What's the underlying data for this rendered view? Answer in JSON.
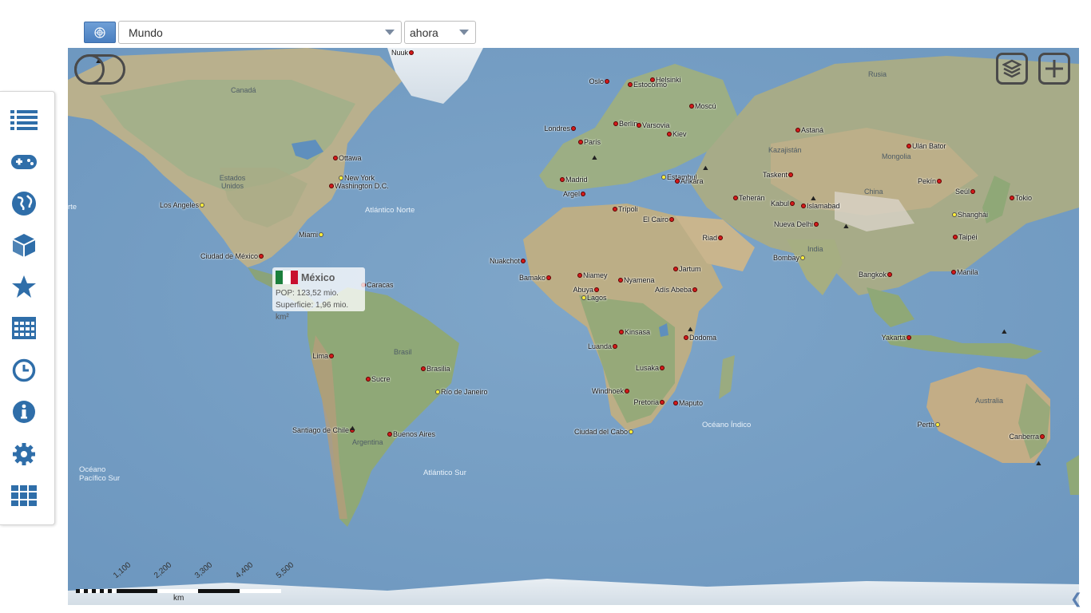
{
  "header": {
    "region_select": {
      "value": "Mundo"
    },
    "time_select": {
      "value": "ahora"
    },
    "flag_icon": "un-flag-icon"
  },
  "sidebar": {
    "items": [
      {
        "icon": "list-icon"
      },
      {
        "icon": "gamepad-icon"
      },
      {
        "icon": "globe-icon"
      },
      {
        "icon": "cube-icon"
      },
      {
        "icon": "star-icon"
      },
      {
        "icon": "calendar-grid-icon"
      },
      {
        "icon": "clock-icon"
      },
      {
        "icon": "info-icon"
      },
      {
        "icon": "gear-icon"
      },
      {
        "icon": "apps-grid-icon"
      }
    ],
    "accent_color": "#2f6ea9"
  },
  "map": {
    "controls": {
      "layers_icon": "layers-icon",
      "add_icon": "plus-icon",
      "toggle_icon": "toggle-icon"
    },
    "regions": [
      "Canadá",
      "Rusia",
      "Estados Unidos",
      "Kazajistán",
      "Mongolia",
      "China",
      "India",
      "Brasil",
      "Argentina",
      "Australia"
    ],
    "oceans": [
      "Atlántico Norte",
      "Atlántico Sur",
      "Océano Índico",
      "Océano Pacífico Sur",
      "rte"
    ],
    "cities": [
      {
        "name": "Nuuk",
        "color": "red"
      },
      {
        "name": "Oslo",
        "color": "red"
      },
      {
        "name": "Helsinki",
        "color": "red"
      },
      {
        "name": "Estocolmo",
        "color": "red"
      },
      {
        "name": "Moscú",
        "color": "red"
      },
      {
        "name": "Londres",
        "color": "red"
      },
      {
        "name": "Berlín",
        "color": "red"
      },
      {
        "name": "Varsovia",
        "color": "red"
      },
      {
        "name": "París",
        "color": "red"
      },
      {
        "name": "Kiev",
        "color": "red"
      },
      {
        "name": "Astaná",
        "color": "red"
      },
      {
        "name": "Ulán Bator",
        "color": "red"
      },
      {
        "name": "Ottawa",
        "color": "red"
      },
      {
        "name": "New York",
        "color": "yellow"
      },
      {
        "name": "Washington D.C.",
        "color": "red"
      },
      {
        "name": "Madrid",
        "color": "red"
      },
      {
        "name": "Estambul",
        "color": "yellow"
      },
      {
        "name": "Ankara",
        "color": "red"
      },
      {
        "name": "Taskent",
        "color": "red"
      },
      {
        "name": "Pekín",
        "color": "red"
      },
      {
        "name": "Seúl",
        "color": "red"
      },
      {
        "name": "Tokio",
        "color": "red"
      },
      {
        "name": "Los Angeles",
        "color": "yellow"
      },
      {
        "name": "Argel",
        "color": "red"
      },
      {
        "name": "Teherán",
        "color": "red"
      },
      {
        "name": "Kabul",
        "color": "red"
      },
      {
        "name": "Islamabad",
        "color": "red"
      },
      {
        "name": "Shanghái",
        "color": "yellow"
      },
      {
        "name": "Trípoli",
        "color": "red"
      },
      {
        "name": "El Cairo",
        "color": "red"
      },
      {
        "name": "Nueva Delhi",
        "color": "red"
      },
      {
        "name": "Miami",
        "color": "yellow"
      },
      {
        "name": "Riad",
        "color": "red"
      },
      {
        "name": "Taipéi",
        "color": "red"
      },
      {
        "name": "Ciudad de México",
        "color": "red"
      },
      {
        "name": "Nuakchot",
        "color": "red"
      },
      {
        "name": "Bombay",
        "color": "yellow"
      },
      {
        "name": "Jartum",
        "color": "red"
      },
      {
        "name": "Caracas",
        "color": "red"
      },
      {
        "name": "Bamako",
        "color": "red"
      },
      {
        "name": "Niamey",
        "color": "red"
      },
      {
        "name": "Nyamena",
        "color": "red"
      },
      {
        "name": "Bangkok",
        "color": "red"
      },
      {
        "name": "Manila",
        "color": "red"
      },
      {
        "name": "Abuya",
        "color": "red"
      },
      {
        "name": "Adís Abeba",
        "color": "red"
      },
      {
        "name": "Lagos",
        "color": "yellow"
      },
      {
        "name": "Kinsasa",
        "color": "red"
      },
      {
        "name": "Dodoma",
        "color": "red"
      },
      {
        "name": "Yakarta",
        "color": "red"
      },
      {
        "name": "Luanda",
        "color": "red"
      },
      {
        "name": "Lima",
        "color": "red"
      },
      {
        "name": "Lusaka",
        "color": "red"
      },
      {
        "name": "Brasilia",
        "color": "red"
      },
      {
        "name": "Sucre",
        "color": "red"
      },
      {
        "name": "Río de Janeiro",
        "color": "yellow"
      },
      {
        "name": "Windhoek",
        "color": "red"
      },
      {
        "name": "Pretoria",
        "color": "red"
      },
      {
        "name": "Maputo",
        "color": "red"
      },
      {
        "name": "Perth",
        "color": "yellow"
      },
      {
        "name": "Santiago de Chile",
        "color": "red"
      },
      {
        "name": "Buenos Aires",
        "color": "red"
      },
      {
        "name": "Ciudad del Cabo",
        "color": "yellow"
      },
      {
        "name": "Canberra",
        "color": "red"
      }
    ],
    "popup": {
      "title": "México",
      "pop": "POP: 123,52 mio.",
      "area": "Superficie: 1,96 mio. km²"
    },
    "scale": {
      "ticks": [
        "1,100",
        "2,200",
        "3,300",
        "4,400",
        "5,500"
      ],
      "unit": "km"
    }
  },
  "footer": {
    "collapse_icon": "chevron-left-icon"
  }
}
